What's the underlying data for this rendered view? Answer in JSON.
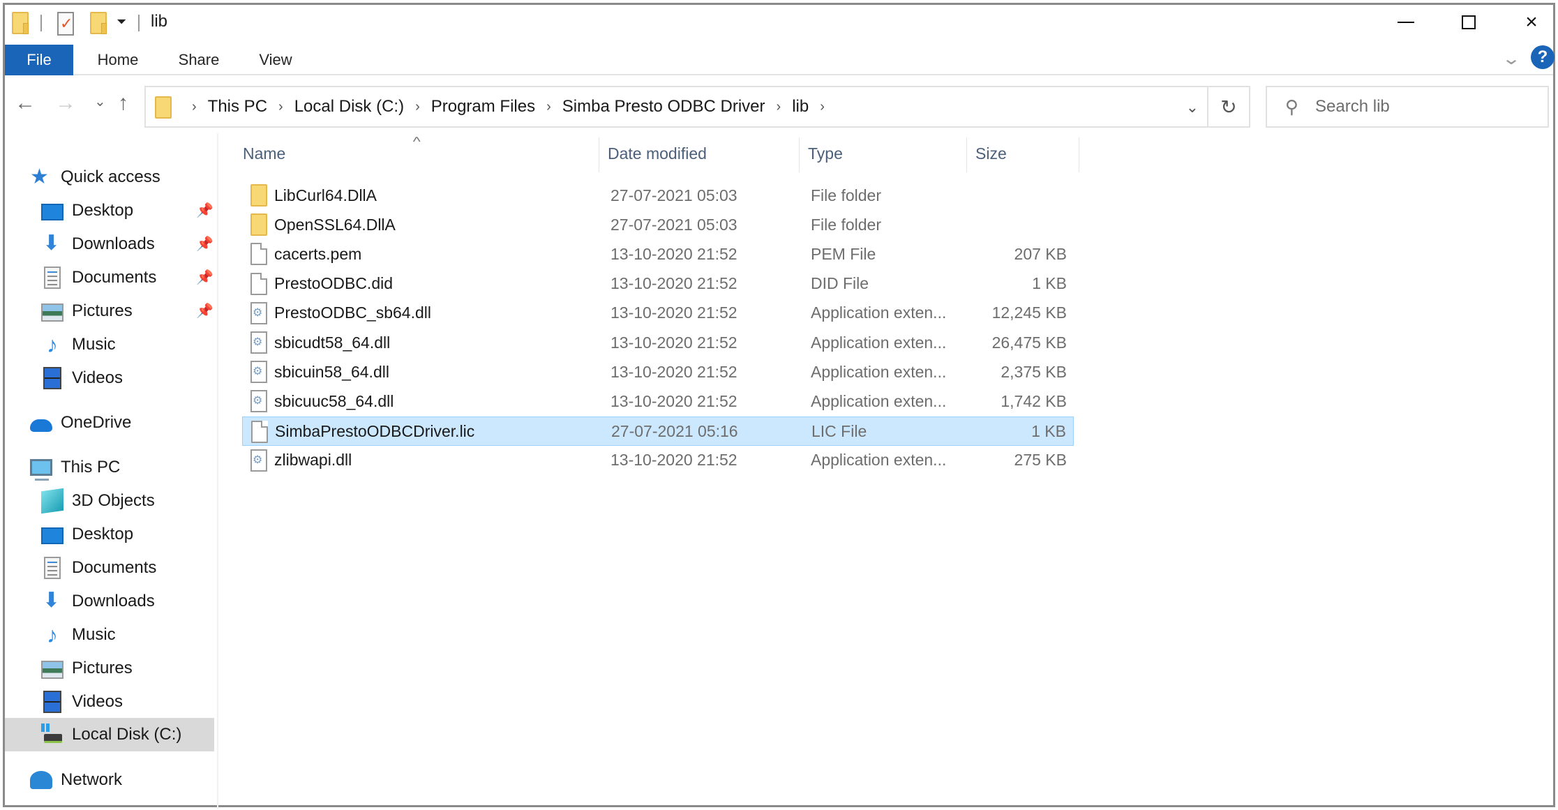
{
  "window": {
    "title": "lib",
    "controls": {
      "minimize": "minimize",
      "maximize": "maximize",
      "close": "×"
    }
  },
  "ribbon": {
    "tabs": [
      {
        "label": "File",
        "active": true
      },
      {
        "label": "Home"
      },
      {
        "label": "Share"
      },
      {
        "label": "View"
      }
    ],
    "expand_icon": "⌄",
    "help_label": "?"
  },
  "nav": {
    "back_icon": "←",
    "forward_icon": "→",
    "recent_icon": "⌄",
    "up_icon": "↑",
    "breadcrumb": [
      "This PC",
      "Local Disk (C:)",
      "Program Files",
      "Simba Presto ODBC Driver",
      "lib"
    ],
    "separator": "›",
    "dropdown_icon": "⌄",
    "refresh_icon": "↻",
    "search": {
      "placeholder": "Search lib",
      "icon": "⚲"
    }
  },
  "sidebar": {
    "quick_access": {
      "label": "Quick access",
      "icon": "★"
    },
    "quick_items": [
      {
        "label": "Desktop",
        "icon": "desktop",
        "pinned": true
      },
      {
        "label": "Downloads",
        "icon": "downloads",
        "pinned": true
      },
      {
        "label": "Documents",
        "icon": "documents",
        "pinned": true
      },
      {
        "label": "Pictures",
        "icon": "pictures",
        "pinned": true
      },
      {
        "label": "Music",
        "icon": "music",
        "pinned": false
      },
      {
        "label": "Videos",
        "icon": "videos",
        "pinned": false
      }
    ],
    "onedrive": {
      "label": "OneDrive"
    },
    "this_pc": {
      "label": "This PC"
    },
    "pc_items": [
      {
        "label": "3D Objects",
        "icon": "3d-objects"
      },
      {
        "label": "Desktop",
        "icon": "desktop"
      },
      {
        "label": "Documents",
        "icon": "documents"
      },
      {
        "label": "Downloads",
        "icon": "downloads"
      },
      {
        "label": "Music",
        "icon": "music"
      },
      {
        "label": "Pictures",
        "icon": "pictures"
      },
      {
        "label": "Videos",
        "icon": "videos"
      },
      {
        "label": "Local Disk (C:)",
        "icon": "local-disk",
        "selected": true
      }
    ],
    "network": {
      "label": "Network"
    },
    "pin_glyph": "📌",
    "music_glyph": "♪",
    "star_glyph": "★"
  },
  "filelist": {
    "columns": {
      "name": "Name",
      "date": "Date modified",
      "type": "Type",
      "size": "Size"
    },
    "sort_indicator": "^",
    "rows": [
      {
        "name": "LibCurl64.DllA",
        "date": "27-07-2021 05:03",
        "type": "File folder",
        "size": "",
        "kind": "folder"
      },
      {
        "name": "OpenSSL64.DllA",
        "date": "27-07-2021 05:03",
        "type": "File folder",
        "size": "",
        "kind": "folder"
      },
      {
        "name": "cacerts.pem",
        "date": "13-10-2020 21:52",
        "type": "PEM File",
        "size": "207 KB",
        "kind": "file"
      },
      {
        "name": "PrestoODBC.did",
        "date": "13-10-2020 21:52",
        "type": "DID File",
        "size": "1 KB",
        "kind": "file"
      },
      {
        "name": "PrestoODBC_sb64.dll",
        "date": "13-10-2020 21:52",
        "type": "Application exten...",
        "size": "12,245 KB",
        "kind": "dll"
      },
      {
        "name": "sbicudt58_64.dll",
        "date": "13-10-2020 21:52",
        "type": "Application exten...",
        "size": "26,475 KB",
        "kind": "dll"
      },
      {
        "name": "sbicuin58_64.dll",
        "date": "13-10-2020 21:52",
        "type": "Application exten...",
        "size": "2,375 KB",
        "kind": "dll"
      },
      {
        "name": "sbicuuc58_64.dll",
        "date": "13-10-2020 21:52",
        "type": "Application exten...",
        "size": "1,742 KB",
        "kind": "dll"
      },
      {
        "name": "SimbaPrestoODBCDriver.lic",
        "date": "27-07-2021 05:16",
        "type": "LIC File",
        "size": "1 KB",
        "kind": "file",
        "selected": true
      },
      {
        "name": "zlibwapi.dll",
        "date": "13-10-2020 21:52",
        "type": "Application exten...",
        "size": "275 KB",
        "kind": "dll"
      }
    ]
  },
  "colors": {
    "accent": "#1a65b7",
    "selection_bg": "#cce8ff",
    "selection_border": "#99d1ff",
    "nav_selected_bg": "#d9d9d9",
    "header_text": "#4c607a"
  }
}
